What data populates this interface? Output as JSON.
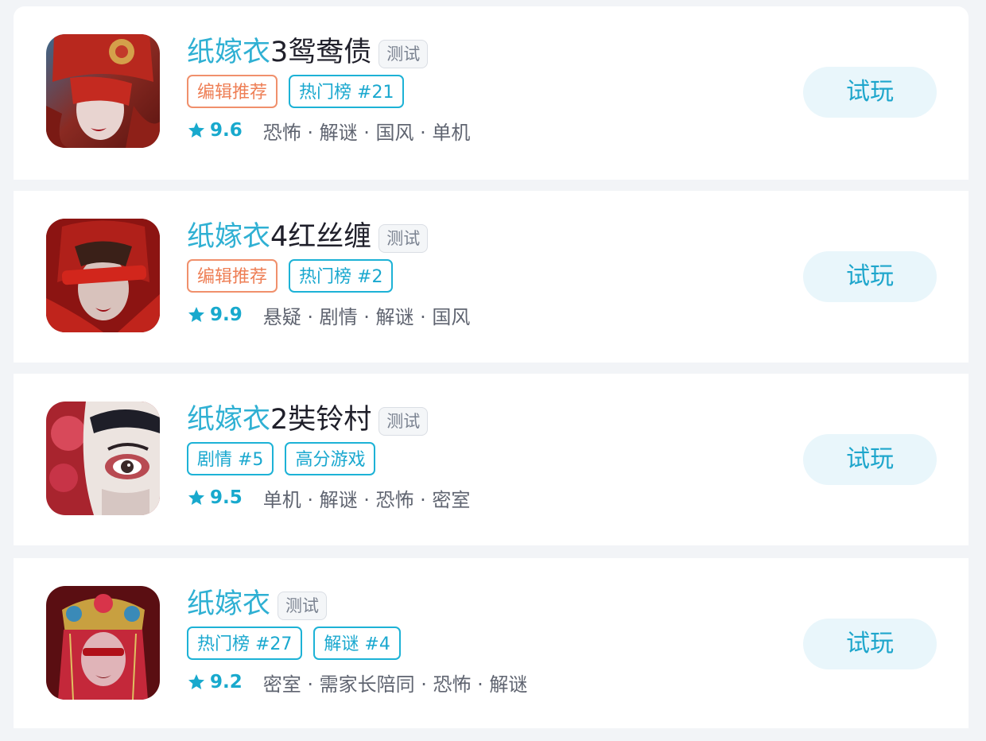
{
  "games": [
    {
      "title_series": "纸嫁衣",
      "title_suffix": "3鸳鸯债",
      "test_badge": "测试",
      "tags": [
        {
          "label": "编辑推荐",
          "style": "editor"
        },
        {
          "label": "热门榜 #21",
          "style": "rank"
        }
      ],
      "rating": "9.6",
      "genres": "恐怖 · 解谜 · 国风 · 单机",
      "play_label": "试玩",
      "icon_name": "game-icon-bride-red-veil"
    },
    {
      "title_series": "纸嫁衣",
      "title_suffix": "4红丝缠",
      "test_badge": "测试",
      "tags": [
        {
          "label": "编辑推荐",
          "style": "editor"
        },
        {
          "label": "热门榜 #2",
          "style": "rank"
        }
      ],
      "rating": "9.9",
      "genres": "悬疑 · 剧情 · 解谜 · 国风",
      "play_label": "试玩",
      "icon_name": "game-icon-bride-red-ribbon"
    },
    {
      "title_series": "纸嫁衣",
      "title_suffix": "2奘铃村",
      "test_badge": "测试",
      "tags": [
        {
          "label": "剧情 #5",
          "style": "rank"
        },
        {
          "label": "高分游戏",
          "style": "rank"
        }
      ],
      "rating": "9.5",
      "genres": "单机 · 解谜 · 恐怖 · 密室",
      "play_label": "试玩",
      "icon_name": "game-icon-opera-mask-eye"
    },
    {
      "title_series": "纸嫁衣",
      "title_suffix": "",
      "test_badge": "测试",
      "tags": [
        {
          "label": "热门榜 #27",
          "style": "rank"
        },
        {
          "label": "解谜 #4",
          "style": "rank"
        }
      ],
      "rating": "9.2",
      "genres": "密室 · 需家长陪同 · 恐怖 · 解谜",
      "play_label": "试玩",
      "icon_name": "game-icon-bride-headdress"
    }
  ],
  "colors": {
    "accent": "#1db2d6",
    "editor_tag": "#f0906c",
    "play_button_bg": "#e9f6fb"
  }
}
